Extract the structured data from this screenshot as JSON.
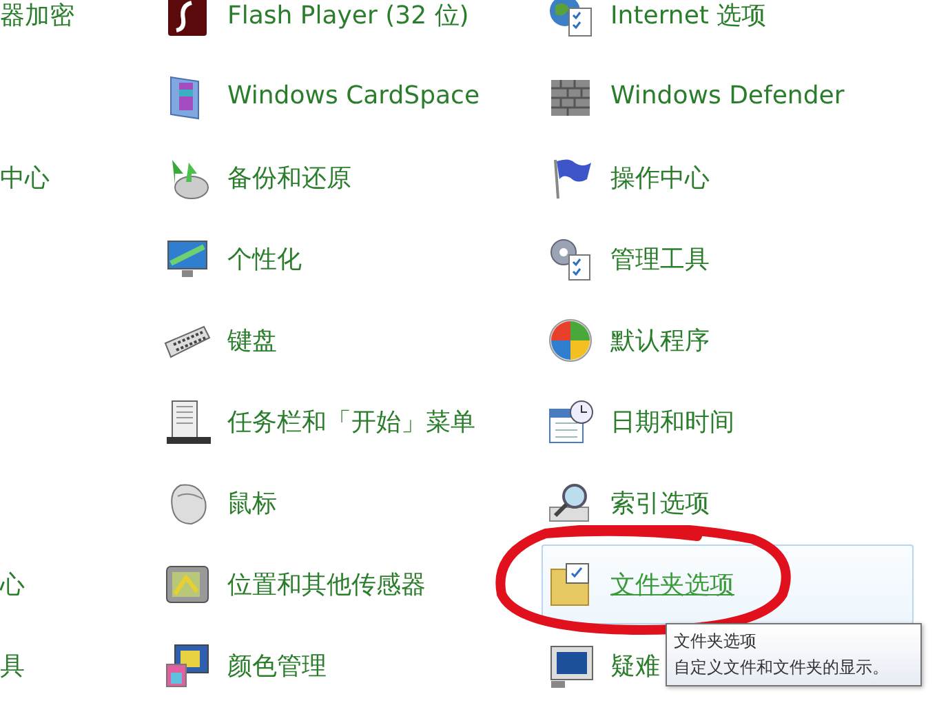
{
  "rows": [
    {
      "column_1": "器加密",
      "column_2": {
        "label": "Flash Player (32 位)",
        "hovered": false
      },
      "column_3": {
        "label": "Internet 选项",
        "hovered": false
      }
    },
    {
      "column_2": {
        "label": "Windows CardSpace",
        "hovered": false
      },
      "column_3": {
        "label": "Windows Defender",
        "hovered": false
      }
    },
    {
      "column_1": "中心",
      "column_2": {
        "label": "备份和还原",
        "hovered": false
      },
      "column_3": {
        "label": "操作中心",
        "hovered": false
      }
    },
    {
      "column_2": {
        "label": "个性化",
        "hovered": false
      },
      "column_3": {
        "label": "管理工具",
        "hovered": false
      }
    },
    {
      "column_2": {
        "label": "键盘",
        "hovered": false
      },
      "column_3": {
        "label": "默认程序",
        "hovered": false
      }
    },
    {
      "column_2": {
        "label": "任务栏和「开始」菜单",
        "hovered": false
      },
      "column_3": {
        "label": "日期和时间",
        "hovered": false
      }
    },
    {
      "column_2": {
        "label": "鼠标",
        "hovered": false
      },
      "column_3": {
        "label": "索引选项",
        "hovered": false
      }
    },
    {
      "column_1": "心",
      "column_2": {
        "label": "位置和其他传感器",
        "hovered": false
      },
      "column_3": {
        "label": "文件夹选项",
        "hovered": true
      }
    },
    {
      "column_1": "具",
      "column_2": {
        "label": "颜色管理",
        "hovered": false
      },
      "column_3": {
        "label": "疑难",
        "hovered": false
      }
    }
  ],
  "tooltip": {
    "title": "文件夹选项",
    "description": "自定义文件和文件夹的显示。"
  }
}
